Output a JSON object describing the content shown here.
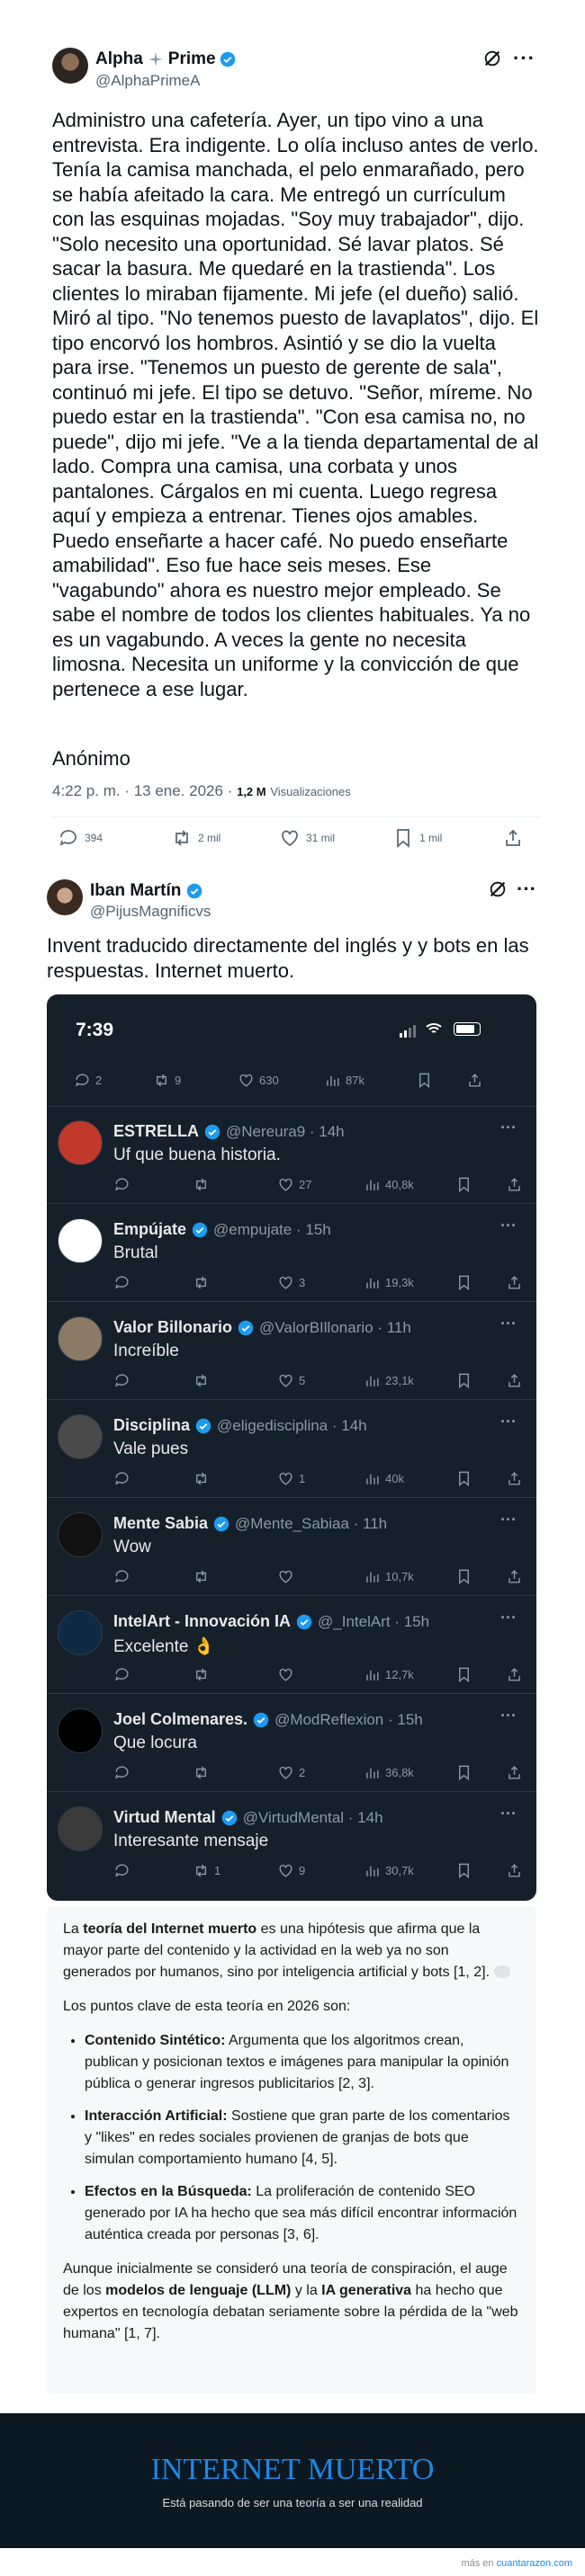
{
  "tweet1": {
    "name": "Alpha",
    "name_suffix": "Prime",
    "handle": "@AlphaPrimeA",
    "text": "Administro una cafetería. Ayer, un tipo vino a una entrevista. Era indigente. Lo olía incluso antes de verlo. Tenía la camisa manchada, el pelo enmarañado, pero se había afeitado la cara. Me entregó un currículum con las esquinas mojadas. \"Soy muy trabajador\", dijo. \"Solo necesito una oportunidad. Sé lavar platos. Sé sacar la basura. Me quedaré en la trastienda\". Los clientes lo miraban fijamente. Mi jefe (el dueño) salió. Miró al tipo. \"No tenemos puesto de lavaplatos\", dijo. El tipo encorvó los hombros. Asintió y se dio la vuelta para irse. \"Tenemos un puesto de gerente de sala\", continuó mi jefe. El tipo se detuvo. \"Señor, míreme. No puedo estar en la trastienda\". \"Con esa camisa no, no puede\", dijo mi jefe. \"Ve a la tienda departamental de al lado. Compra una camisa, una corbata y unos pantalones. Cárgalos en mi cuenta. Luego regresa aquí y empieza a entrenar. Tienes ojos amables. Puedo enseñarte a hacer café. No puedo enseñarte amabilidad\". Eso fue hace seis meses. Ese \"vagabundo\" ahora es nuestro mejor empleado. Se sabe el nombre de todos los clientes habituales. Ya no es un vagabundo. A veces la gente no necesita limosna. Necesita un uniforme y la convicción de que pertenece a ese lugar.",
    "signature": "Anónimo",
    "time": "4:22 p. m. · 13 ene. 2026 ·",
    "views_count": "1,2 M",
    "views_label": "Visualizaciones",
    "replies": "394",
    "retweets": "2 mil",
    "likes": "31 mil",
    "bookmarks": "1 mil"
  },
  "tweet2": {
    "name": "Iban Martín",
    "handle": "@PijusMagnificvs",
    "text": "Invent traducido directamente del inglés y y bots en las respuestas. Internet muerto."
  },
  "phone": {
    "time": "7:39",
    "top_actions": {
      "replies": "2",
      "retweets": "9",
      "likes": "630",
      "views": "87k"
    },
    "replies": [
      {
        "name": "ESTRELLA",
        "handle": "@Nereura9 · 14h",
        "text": "Uf que buena historia.",
        "replies": "",
        "retweets": "",
        "likes": "27",
        "views": "40,8k",
        "avatar_color": "#c0392b"
      },
      {
        "name": "Empújate",
        "handle": "@empujate · 15h",
        "text": "Brutal",
        "replies": "",
        "retweets": "",
        "likes": "3",
        "views": "19,3k",
        "avatar_color": "#ffffff"
      },
      {
        "name": "Valor Billonario",
        "handle": "@ValorBIllonario · 11h",
        "text": "Increíble",
        "replies": "",
        "retweets": "",
        "likes": "5",
        "views": "23,1k",
        "avatar_color": "#8a7a66"
      },
      {
        "name": "Disciplina",
        "handle": "@eligedisciplina · 14h",
        "text": "Vale pues",
        "replies": "",
        "retweets": "",
        "likes": "1",
        "views": "40k",
        "avatar_color": "#4a4a4a"
      },
      {
        "name": "Mente Sabia",
        "handle": "@Mente_Sabiaa · 11h",
        "text": "Wow",
        "replies": "",
        "retweets": "",
        "likes": "",
        "views": "10,7k",
        "avatar_color": "#111111"
      },
      {
        "name": "IntelArt - Innovación IA",
        "handle": "@_IntelArt · 15h",
        "text": "Excelente 👌",
        "replies": "",
        "retweets": "",
        "likes": "",
        "views": "12,7k",
        "avatar_color": "#0f2a44"
      },
      {
        "name": "Joel Colmenares.",
        "handle": "@ModReflexion · 15h",
        "text": "Que locura",
        "replies": "",
        "retweets": "",
        "likes": "2",
        "views": "36,8k",
        "avatar_color": "#000000"
      },
      {
        "name": "Virtud Mental",
        "handle": "@VirtudMental · 14h",
        "text": "Interesante mensaje",
        "replies": "",
        "retweets": "1",
        "likes": "9",
        "views": "30,7k",
        "avatar_color": "#3a3a3a"
      }
    ]
  },
  "card": {
    "p1_a": "La ",
    "p1_b": "teoría del Internet muerto",
    "p1_c": " es una hipótesis que afirma que la mayor parte del contenido y la actividad en la web ya no son generados por humanos, sino por inteligencia artificial y bots [1, 2].",
    "p2": "Los puntos clave de esta teoría en 2026 son:",
    "b1_title": "Contenido Sintético:",
    "b1_text": " Argumenta que los algoritmos crean, publican y posicionan textos e imágenes para manipular la opinión pública o generar ingresos publicitarios [2, 3].",
    "b2_title": "Interacción Artificial:",
    "b2_text": " Sostiene que gran parte de los comentarios y \"likes\" en redes sociales provienen de granjas de bots que simulan comportamiento humano [4, 5].",
    "b3_title": "Efectos en la Búsqueda:",
    "b3_text": " La proliferación de contenido SEO generado por IA ha hecho que sea más difícil encontrar información auténtica creada por personas [3, 6].",
    "p3_a": "Aunque inicialmente se consideró una teoría de conspiración, el auge de los ",
    "p3_b": "modelos de lenguaje (LLM)",
    "p3_c": " y la ",
    "p3_d": "IA generativa",
    "p3_e": " ha hecho que expertos en tecnología debatan seriamente sobre la pérdida de la \"web humana\" [1, 7]."
  },
  "footer": {
    "title": "INTERNET MUERTO",
    "subtitle": "Está pasando de ser una teoría a ser una realidad",
    "credit_prefix": "más en",
    "credit_site": "cuantarazon.com"
  },
  "colors": {
    "accent": "#1d9bf0",
    "footer_title": "#1e88e5",
    "dark_bg": "#15202b"
  }
}
